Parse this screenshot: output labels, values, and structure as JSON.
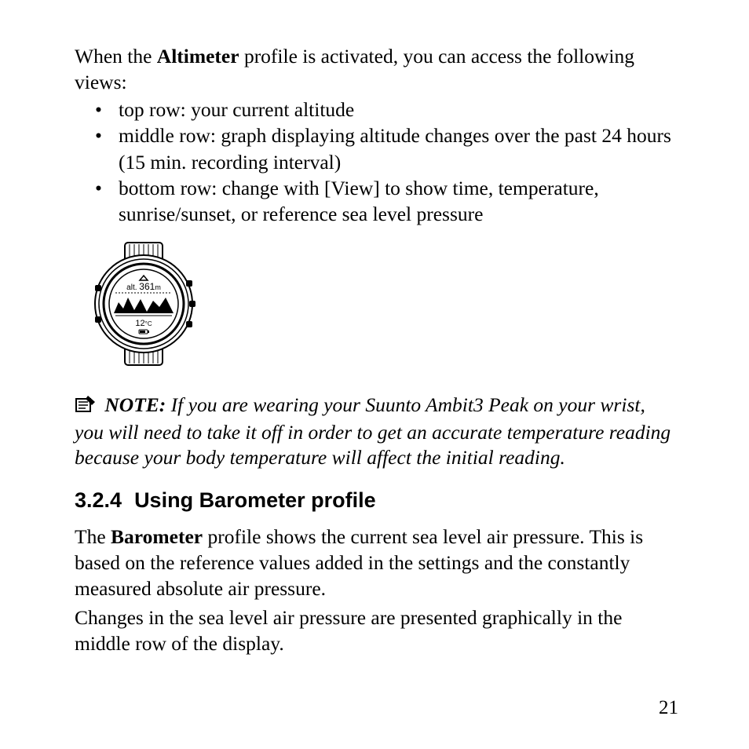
{
  "intro": {
    "prefix": "When the ",
    "bold": "Altimeter",
    "suffix": " profile is activated, you can access the following views:"
  },
  "bullets": [
    "top row: your current altitude",
    "middle row: graph displaying altitude changes over the past 24 hours (15 min. recording interval)",
    "bottom row: change with [View] to show time, temperature, sunrise/sunset, or reference sea level pressure"
  ],
  "watch": {
    "alt_label": "alt.",
    "alt_value": "361",
    "alt_unit": "m",
    "temp_value": "12",
    "temp_unit": "°C"
  },
  "note": {
    "label": "NOTE:",
    "text": " If you are wearing your Suunto Ambit3 Peak on your wrist, you will need to take it off in order to get an accurate temperature reading because your body temperature will affect the initial reading."
  },
  "section": {
    "number": "3.2.4",
    "title": "Using Barometer profile"
  },
  "baro_para1": {
    "prefix": "The ",
    "bold": "Barometer",
    "suffix": " profile shows the current sea level air pressure. This is based on the reference values added in the settings and the constantly measured absolute air pressure."
  },
  "baro_para2": "Changes in the sea level air pressure are presented graphically in the middle row of the display.",
  "page_number": "21"
}
